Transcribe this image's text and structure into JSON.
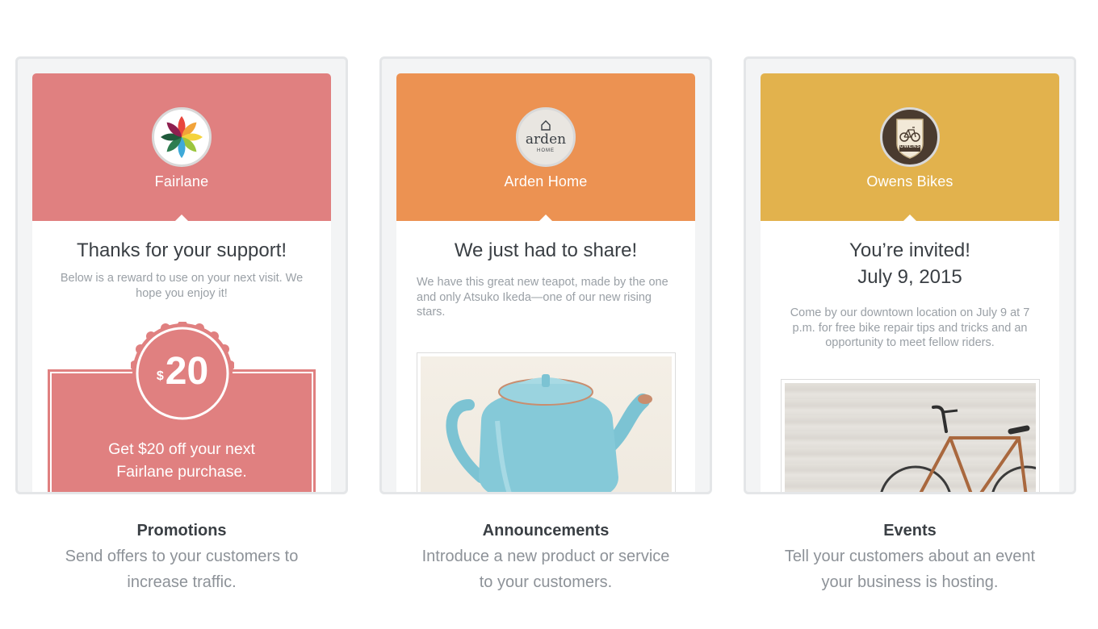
{
  "cards": [
    {
      "brand": "Fairlane",
      "header_color": "#e08080",
      "logo_icon": "flower-logo-icon",
      "headline": "Thanks for your support!",
      "body": "Below is a reward to use on your next visit. We hope you enjoy it!",
      "badge_currency": "$",
      "badge_amount": "20",
      "coupon_text_line1": "Get $20 off your next",
      "coupon_text_line2": "Fairlane purchase.",
      "caption_title": "Promotions",
      "caption_line1": "Send offers to your customers to",
      "caption_line2": "increase traffic."
    },
    {
      "brand": "Arden Home",
      "header_color": "#ec9252",
      "logo_icon": "arden-home-logo-icon",
      "logo_word": "arden",
      "logo_small": "HOME",
      "headline": "We just had to share!",
      "body": "We have this great new teapot, made by the one and only Atsuko Ikeda—one of our new rising stars.",
      "image_icon": "teapot-photo",
      "caption_title": "Announcements",
      "caption_line1": "Introduce a new product or service",
      "caption_line2": "to your customers."
    },
    {
      "brand": "Owens Bikes",
      "header_color": "#e2b24d",
      "logo_icon": "owens-bike-logo-icon",
      "logo_word": "OWENS",
      "headline_line1": "You’re invited!",
      "headline_line2": "July 9, 2015",
      "body": "Come by our downtown location on July 9 at 7 p.m. for free bike repair tips and tricks and an opportunity to meet fellow riders.",
      "image_icon": "bicycle-photo",
      "caption_title": "Events",
      "caption_line1": "Tell your customers about an event",
      "caption_line2": "your business is hosting."
    }
  ]
}
